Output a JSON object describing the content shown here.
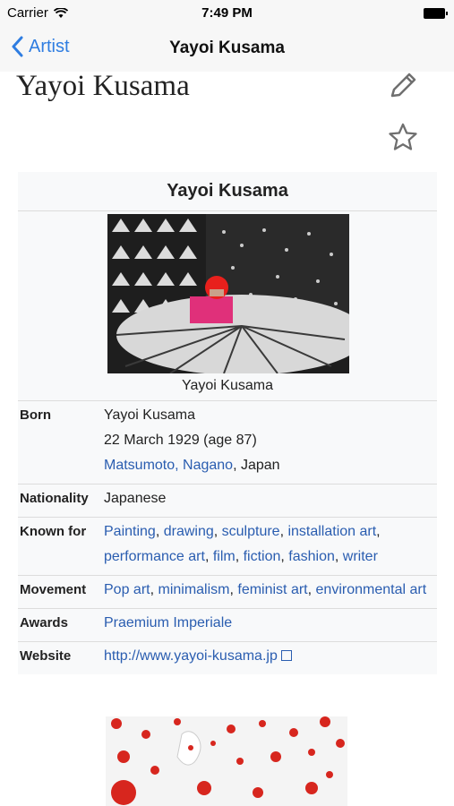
{
  "status_bar": {
    "carrier": "Carrier",
    "time": "7:49 PM"
  },
  "nav": {
    "back_label": "Artist",
    "title": "Yayoi Kusama"
  },
  "page": {
    "heading": "Yayoi Kusama"
  },
  "infobox": {
    "title": "Yayoi Kusama",
    "caption": "Yayoi Kusama",
    "rows": {
      "born": {
        "label": "Born",
        "name": "Yayoi Kusama",
        "date": "22 March 1929 (age 87)",
        "place_link": "Matsumoto, Nagano",
        "place_rest": ", Japan"
      },
      "nationality": {
        "label": "Nationality",
        "value": "Japanese"
      },
      "known_for": {
        "label": "Known for",
        "links": [
          "Painting",
          "drawing",
          "sculpture",
          "installation art",
          "performance art",
          "film",
          "fiction",
          "fashion",
          "writer"
        ]
      },
      "movement": {
        "label": "Movement",
        "links": [
          "Pop art",
          "minimalism",
          "feminist art",
          "environmental art"
        ]
      },
      "awards": {
        "label": "Awards",
        "value": "Praemium Imperiale"
      },
      "website": {
        "label": "Website",
        "value": "http://www.yayoi-kusama.jp"
      }
    }
  },
  "colors": {
    "link": "#2a5db0",
    "nav_tint": "#2f7de1",
    "infobox_bg": "#f8f9fa"
  },
  "icons": [
    "wifi-icon",
    "battery-icon",
    "back-chevron-icon",
    "edit-pencil-icon",
    "star-outline-icon",
    "external-link-icon"
  ]
}
